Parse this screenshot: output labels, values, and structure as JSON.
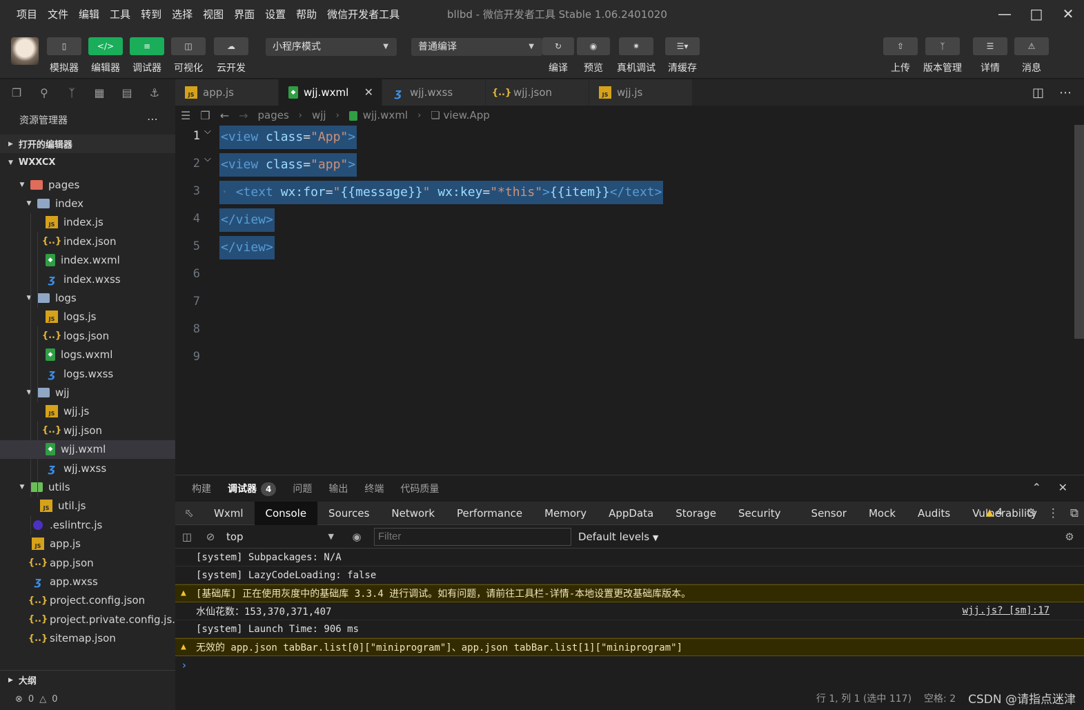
{
  "menu": [
    "项目",
    "文件",
    "编辑",
    "工具",
    "转到",
    "选择",
    "视图",
    "界面",
    "设置",
    "帮助",
    "微信开发者工具"
  ],
  "window_title": "bllbd - 微信开发者工具 Stable 1.06.2401020",
  "toolbar": {
    "left_buttons": [
      "模拟器",
      "编辑器",
      "调试器",
      "可视化",
      "云开发"
    ],
    "mode_select": "小程序模式",
    "compile_select": "普通编译",
    "mid_buttons": [
      "编译",
      "预览",
      "真机调试",
      "清缓存"
    ],
    "right_buttons": [
      "上传",
      "版本管理",
      "详情",
      "消息"
    ]
  },
  "tabs": [
    {
      "label": "app.js",
      "type": "js",
      "active": false
    },
    {
      "label": "wjj.wxml",
      "type": "wxml",
      "active": true
    },
    {
      "label": "wjj.wxss",
      "type": "wxss",
      "active": false
    },
    {
      "label": "wjj.json",
      "type": "json",
      "active": false
    },
    {
      "label": "wjj.js",
      "type": "js",
      "active": false
    }
  ],
  "sidebar": {
    "title": "资源管理器",
    "open_editors": "打开的编辑器",
    "project": "WXXCX",
    "tree": [
      {
        "label": "pages",
        "type": "folder-red",
        "depth": 1,
        "arrow": "▼"
      },
      {
        "label": "index",
        "type": "folder",
        "depth": 2,
        "arrow": "▼"
      },
      {
        "label": "index.js",
        "type": "js",
        "depth": 3
      },
      {
        "label": "index.json",
        "type": "json",
        "depth": 3
      },
      {
        "label": "index.wxml",
        "type": "wxml",
        "depth": 3
      },
      {
        "label": "index.wxss",
        "type": "wxss",
        "depth": 3
      },
      {
        "label": "logs",
        "type": "folder",
        "depth": 2,
        "arrow": "▼"
      },
      {
        "label": "logs.js",
        "type": "js",
        "depth": 3
      },
      {
        "label": "logs.json",
        "type": "json",
        "depth": 3
      },
      {
        "label": "logs.wxml",
        "type": "wxml",
        "depth": 3
      },
      {
        "label": "logs.wxss",
        "type": "wxss",
        "depth": 3
      },
      {
        "label": "wjj",
        "type": "folder",
        "depth": 2,
        "arrow": "▼"
      },
      {
        "label": "wjj.js",
        "type": "js",
        "depth": 3
      },
      {
        "label": "wjj.json",
        "type": "json",
        "depth": 3
      },
      {
        "label": "wjj.wxml",
        "type": "wxml",
        "depth": 3,
        "selected": true
      },
      {
        "label": "wjj.wxss",
        "type": "wxss",
        "depth": 3
      },
      {
        "label": "utils",
        "type": "folder-green",
        "depth": 1,
        "arrow": "▼"
      },
      {
        "label": "util.js",
        "type": "js",
        "depth": 2
      },
      {
        "label": ".eslintrc.js",
        "type": "eslint",
        "depth": 1
      },
      {
        "label": "app.js",
        "type": "js",
        "depth": 1
      },
      {
        "label": "app.json",
        "type": "json",
        "depth": 1
      },
      {
        "label": "app.wxss",
        "type": "wxss",
        "depth": 1
      },
      {
        "label": "project.config.json",
        "type": "json",
        "depth": 1
      },
      {
        "label": "project.private.config.js...",
        "type": "json",
        "depth": 1
      },
      {
        "label": "sitemap.json",
        "type": "json",
        "depth": 1
      }
    ],
    "outline": "大纲",
    "errors": "0",
    "warnings": "0"
  },
  "breadcrumb": [
    "pages",
    "wjj",
    "wjj.wxml",
    "view.App"
  ],
  "editor": {
    "line_numbers": [
      "1",
      "2",
      "3",
      "4",
      "5",
      "6",
      "7",
      "8",
      "9"
    ],
    "lines": [
      [
        {
          "t": "tag",
          "v": "<view"
        },
        {
          "t": "ws",
          "v": " "
        },
        {
          "t": "attr",
          "v": "class"
        },
        {
          "t": "punc",
          "v": "="
        },
        {
          "t": "str",
          "v": "\"App\""
        },
        {
          "t": "tag",
          "v": ">"
        }
      ],
      [
        {
          "t": "tag",
          "v": "<view"
        },
        {
          "t": "ws",
          "v": " "
        },
        {
          "t": "attr",
          "v": "class"
        },
        {
          "t": "punc",
          "v": "="
        },
        {
          "t": "str",
          "v": "\"app\""
        },
        {
          "t": "tag",
          "v": ">"
        }
      ],
      [
        {
          "t": "ws",
          "v": "· "
        },
        {
          "t": "tag",
          "v": "<text"
        },
        {
          "t": "ws",
          "v": " "
        },
        {
          "t": "attr",
          "v": "wx:for"
        },
        {
          "t": "punc",
          "v": "="
        },
        {
          "t": "str",
          "v": "\""
        },
        {
          "t": "attr",
          "v": "{{message}}"
        },
        {
          "t": "str",
          "v": "\""
        },
        {
          "t": "ws",
          "v": " "
        },
        {
          "t": "attr",
          "v": "wx:key"
        },
        {
          "t": "punc",
          "v": "="
        },
        {
          "t": "str",
          "v": "\"*this\""
        },
        {
          "t": "tag",
          "v": ">"
        },
        {
          "t": "attr",
          "v": "{{item}}"
        },
        {
          "t": "tag",
          "v": "</text>"
        }
      ],
      [
        {
          "t": "tag",
          "v": "</view>"
        }
      ],
      [
        {
          "t": "tag",
          "v": "</view>"
        }
      ]
    ]
  },
  "panel": {
    "tabs": [
      "构建",
      "调试器",
      "问题",
      "输出",
      "终端",
      "代码质量"
    ],
    "active_tab": "调试器",
    "debugger_badge": "4",
    "devtools_tabs": [
      "Wxml",
      "Console",
      "Sources",
      "Network",
      "Performance",
      "Memory",
      "AppData",
      "Storage",
      "Security",
      "Sensor",
      "Mock",
      "Audits",
      "Vulnerability"
    ],
    "active_devtools_tab": "Console",
    "warning_count": "4",
    "context": "top",
    "filter_placeholder": "Filter",
    "levels": "Default levels",
    "console": [
      {
        "text": "[system] Subpackages: N/A",
        "level": "info"
      },
      {
        "text": "[system] LazyCodeLoading: false",
        "level": "info"
      },
      {
        "text": "[基础库] 正在使用灰度中的基础库 3.3.4 进行调试。如有问题，请前往工具栏-详情-本地设置更改基础库版本。",
        "level": "warn"
      },
      {
        "text": "水仙花数：153,370,371,407",
        "level": "info",
        "source": "wjj.js? [sm]:17"
      },
      {
        "text": "[system] Launch Time: 906 ms",
        "level": "info"
      },
      {
        "text": "无效的 app.json tabBar.list[0][\"miniprogram\"]、app.json tabBar.list[1][\"miniprogram\"]",
        "level": "warn"
      }
    ]
  },
  "status": {
    "position": "行 1, 列 1 (选中 117)",
    "spaces": "空格: 2",
    "watermark": "CSDN @请指点迷津"
  },
  "colors": {
    "accent_green": "#1aad5a",
    "selection": "#264f78",
    "warn_bg": "#332b00"
  }
}
